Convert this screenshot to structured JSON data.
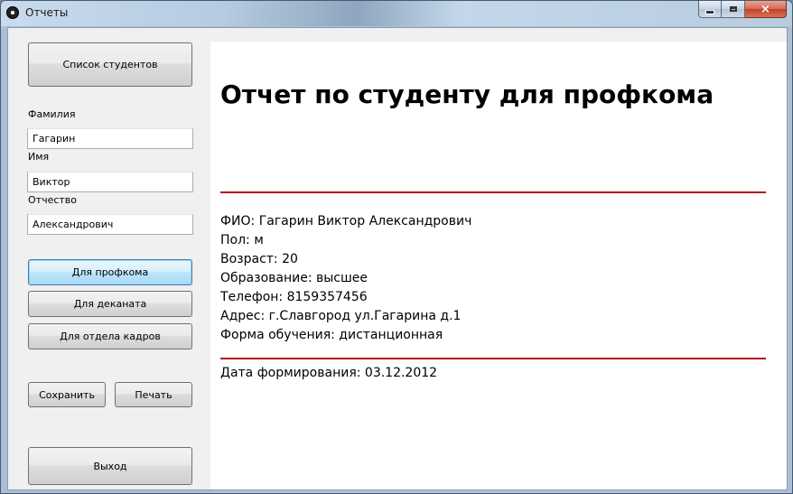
{
  "window": {
    "title": "Отчеты",
    "icon": "app-icon",
    "controls": {
      "minimize": "minimize-icon",
      "maximize": "maximize-icon",
      "close": "×"
    }
  },
  "sidebar": {
    "students_list_button": "Список студентов",
    "fields": {
      "last_name": {
        "label": "Фамилия",
        "value": "Гагарин"
      },
      "first_name": {
        "label": "Имя",
        "value": "Виктор"
      },
      "patronymic": {
        "label": "Отчество",
        "value": "Александрович"
      }
    },
    "report_buttons": {
      "union": "Для профкома",
      "dean": "Для деканата",
      "hr": "Для отдела кадров"
    },
    "save_button": "Сохранить",
    "print_button": "Печать",
    "exit_button": "Выход"
  },
  "report": {
    "title": "Отчет по студенту для профкома",
    "rule_color": "#b4120c",
    "lines": {
      "fio": "ФИО: Гагарин Виктор Александрович",
      "gender": "Пол: м",
      "age": "Возраст: 20",
      "education": "Образование: высшее",
      "phone": "Телефон: 8159357456",
      "address": "Адрес: г.Славгород ул.Гагарина д.1",
      "study_form": "Форма обучения: дистанционная"
    },
    "date": "Дата формирования: 03.12.2012"
  }
}
